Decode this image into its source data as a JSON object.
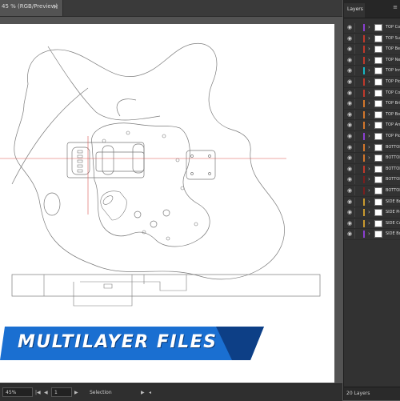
{
  "document": {
    "tab_label": "45 % (RGB/Preview)",
    "close_glyph": "×"
  },
  "banner": {
    "text": "MULTILAYER FILES",
    "color": "#1a6fd1",
    "dark_color": "#0d3f86"
  },
  "layers_panel": {
    "title": "Layers",
    "menu_glyph": "≡",
    "count_label": "20 Layers",
    "layers": [
      {
        "name": "TOP Control",
        "color": "#8a3fd1"
      },
      {
        "name": "TOP Sustain",
        "color": "#c0392b"
      },
      {
        "name": "TOP Bevel",
        "color": "#c0392b"
      },
      {
        "name": "TOP Neck",
        "color": "#c0392b"
      },
      {
        "name": "TOP Inner",
        "color": "#16b6c4"
      },
      {
        "name": "TOP Pickup",
        "color": "#c0392b"
      },
      {
        "name": "TOP Contour",
        "color": "#c0392b"
      },
      {
        "name": "TOP Bridge",
        "color": "#d3762b"
      },
      {
        "name": "TOP Body",
        "color": "#d3762b"
      },
      {
        "name": "TOP Arm",
        "color": "#d3762b"
      },
      {
        "name": "TOP Pickguard",
        "color": "#8a3fd1"
      },
      {
        "name": "BOTTOM",
        "color": "#d3762b"
      },
      {
        "name": "BOTTOM",
        "color": "#d3762b"
      },
      {
        "name": "BOTTOM",
        "color": "#c0392b"
      },
      {
        "name": "BOTTOM",
        "color": "#7a1f1f"
      },
      {
        "name": "BOTTOM",
        "color": "#7a1f1f"
      },
      {
        "name": "SIDE Body",
        "color": "#c99a2e"
      },
      {
        "name": "SIDE Pickup",
        "color": "#c99a2e"
      },
      {
        "name": "SIDE Cut",
        "color": "#c99a2e"
      },
      {
        "name": "SIDE Body",
        "color": "#8a3fd1"
      }
    ]
  },
  "status_bar": {
    "zoom_value": "45%",
    "page_value": "1",
    "tool_label": "Selection"
  }
}
